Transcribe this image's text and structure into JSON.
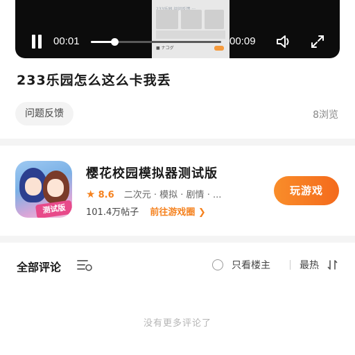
{
  "video": {
    "current_time": "00:01",
    "duration": "00:09",
    "progress": 0.18,
    "thumbnail_caption": "233乐园 问问反馈 ···",
    "thumbnail_tag": "■ ナコグ"
  },
  "post": {
    "title": "233乐园怎么这么卡我丢",
    "tag": "问题反馈",
    "views": "8浏览"
  },
  "game": {
    "name": "樱花校园模拟器测试版",
    "icon_badge": "测试版",
    "rating": "8.6",
    "genres": "二次元 · 模拟 · 剧情 · ...",
    "posts_count": "101.4万帖子",
    "goto_label": "前往游戏圈 ❯",
    "play_label": "玩游戏",
    "accent": "#f5821f"
  },
  "comments": {
    "header": "全部评论",
    "only_author": "只看楼主",
    "sort": "最热",
    "empty": "没有更多评论了"
  }
}
